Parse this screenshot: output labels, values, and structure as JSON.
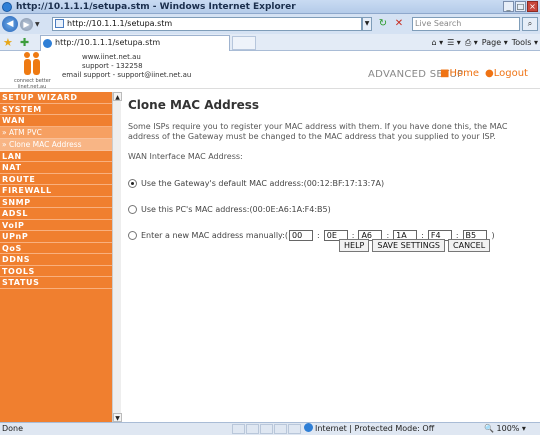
{
  "window": {
    "title": "http://10.1.1.1/setupa.stm - Windows Internet Explorer",
    "minimize": "_",
    "maximize": "□",
    "close": "×"
  },
  "addressbar": {
    "url": "http://10.1.1.1/setupa.stm",
    "search_placeholder": "Live Search"
  },
  "tabbar": {
    "tab_title": "http://10.1.1.1/setupa.stm",
    "commands": [
      "Page ▾",
      "Tools ▾"
    ]
  },
  "header": {
    "logo_tagline": "connect better",
    "logo_url": "iinet.net.au",
    "contact_lines": [
      "www.iinet.net.au",
      "support - 132258",
      "email support - support@iinet.net.au"
    ],
    "section": "ADVANCED SETUP",
    "home": "Home",
    "logout": "Logout"
  },
  "sidebar": {
    "items": [
      {
        "label": "SETUP WIZARD",
        "sub": false
      },
      {
        "label": "SYSTEM",
        "sub": false
      },
      {
        "label": "WAN",
        "sub": false
      },
      {
        "label": "» ATM PVC",
        "sub": true
      },
      {
        "label": "» Clone MAC Address",
        "sub": true,
        "active": true
      },
      {
        "label": "LAN",
        "sub": false
      },
      {
        "label": "NAT",
        "sub": false
      },
      {
        "label": "ROUTE",
        "sub": false
      },
      {
        "label": "FIREWALL",
        "sub": false
      },
      {
        "label": "SNMP",
        "sub": false
      },
      {
        "label": "ADSL",
        "sub": false
      },
      {
        "label": "VoIP",
        "sub": false
      },
      {
        "label": "UPnP",
        "sub": false
      },
      {
        "label": "QoS",
        "sub": false
      },
      {
        "label": "DDNS",
        "sub": false
      },
      {
        "label": "TOOLS",
        "sub": false
      },
      {
        "label": "STATUS",
        "sub": false
      }
    ]
  },
  "main": {
    "title": "Clone MAC Address",
    "description": "Some ISPs require you to register your MAC address with them. If you have done this, the MAC address of the Gateway must be changed to the MAC address that you supplied to your ISP.",
    "sublabel": "WAN Interface MAC Address:",
    "option_default": "Use the Gateway's default MAC address:(00:12:BF:17:13:7A)",
    "option_pc": "Use this PC's MAC address:(00:0E:A6:1A:F4:B5)",
    "option_manual": "Enter a new MAC address manually:(",
    "option_manual_end": ")",
    "selected_option": "default",
    "manual_mac": [
      "00",
      "0E",
      "A6",
      "1A",
      "F4",
      "B5"
    ],
    "buttons": {
      "help": "HELP",
      "save": "SAVE SETTINGS",
      "cancel": "CANCEL"
    }
  },
  "statusbar": {
    "status": "Done",
    "zone": "Internet | Protected Mode: Off",
    "zoom": "100%"
  }
}
